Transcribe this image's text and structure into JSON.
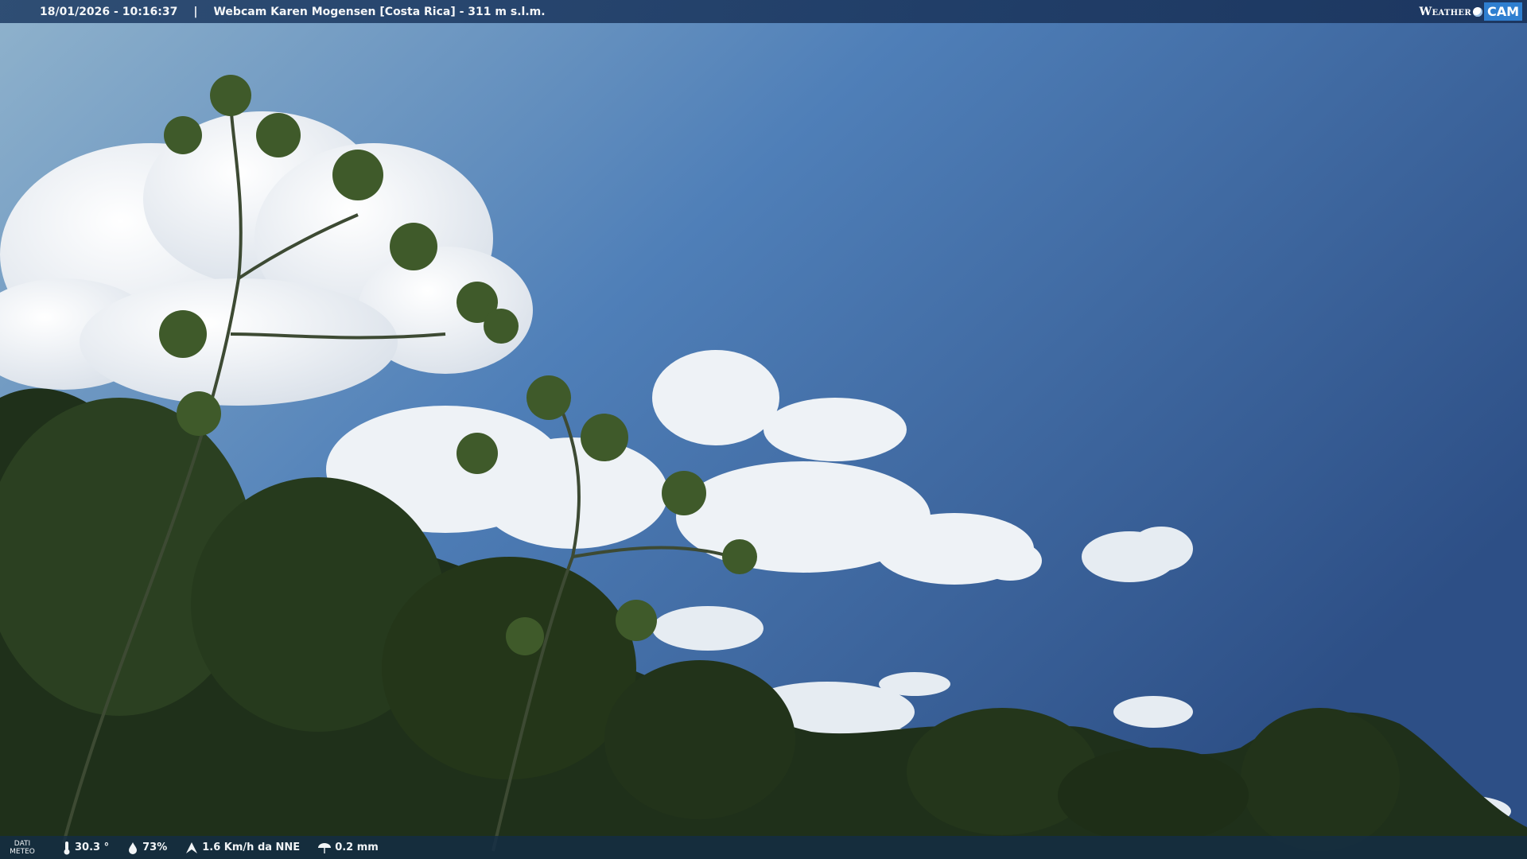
{
  "header": {
    "datetime": "18/01/2026 - 10:16:37",
    "separator": "|",
    "title": "Webcam Karen Mogensen [Costa Rica]  - 311 m s.l.m."
  },
  "brand": {
    "weather": "Weather",
    "cam": "CAM"
  },
  "meteo": {
    "label_line1": "DATI",
    "label_line2": "METEO",
    "temperature": "30.3 °",
    "humidity": "73%",
    "wind": "1.6 Km/h da NNE",
    "rain": "0.2 mm",
    "icons": [
      "thermometer-icon",
      "humidity-icon",
      "wind-icon",
      "rain-icon"
    ]
  },
  "colors": {
    "sky_light": "#8fb2cc",
    "sky_dark": "#2d4f86",
    "foliage": "#2a3d20"
  }
}
